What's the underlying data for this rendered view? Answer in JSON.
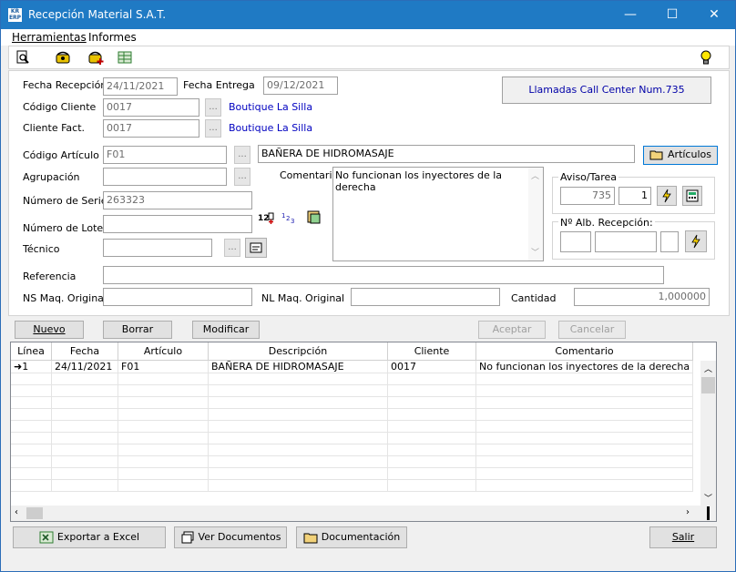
{
  "window": {
    "title": "Recepción Material S.A.T.",
    "app_icon_text": "KR ERP",
    "minimize": "—",
    "maximize": "☐",
    "close": "✕"
  },
  "menu": {
    "herramientas": "Herramientas",
    "informes": "Informes"
  },
  "form": {
    "fecha_recepcion_label": "Fecha Recepción",
    "fecha_recepcion_value": "24/11/2021",
    "fecha_entrega_label": "Fecha Entrega",
    "fecha_entrega_value": "09/12/2021",
    "codigo_cliente_label": "Código Cliente",
    "codigo_cliente_value": "0017",
    "codigo_cliente_name": "Boutique La Silla",
    "cliente_fact_label": "Cliente Fact.",
    "cliente_fact_value": "0017",
    "cliente_fact_name": "Boutique La Silla",
    "call_center": "Llamadas Call Center Num.735",
    "codigo_articulo_label": "Código Artículo",
    "codigo_articulo_value": "F01",
    "articulo_desc": "BAÑERA DE HIDROMASAJE",
    "articulos_button": "Artículos",
    "agrupacion_label": "Agrupación",
    "agrupacion_value": "",
    "comentario_label": "Comentario",
    "comentario_value": "No funcionan los inyectores de la derecha",
    "numero_serie_label": "Número de Serie",
    "numero_serie_value": "263323",
    "numero_lote_label": "Número de Lote",
    "numero_lote_value": "",
    "tecnico_label": "Técnico",
    "tecnico_value": "",
    "aviso_label": "Aviso/Tarea",
    "aviso_value": "735",
    "tarea_value": "1",
    "nalb_label": "Nº Alb. Recepción:",
    "referencia_label": "Referencia",
    "referencia_value": "",
    "ns_label": "NS Maq. Original",
    "ns_value": "",
    "nl_label": "NL Maq. Original",
    "nl_value": "",
    "cantidad_label": "Cantidad",
    "cantidad_value": "1,000000",
    "dots": "..."
  },
  "actions": {
    "nuevo": "Nuevo",
    "borrar": "Borrar",
    "modificar": "Modificar",
    "aceptar": "Aceptar",
    "cancelar": "Cancelar"
  },
  "grid": {
    "headers": [
      "Línea",
      "Fecha",
      "Artículo",
      "Descripción",
      "Cliente",
      "Comentario"
    ],
    "rows": [
      {
        "linea": "1",
        "fecha": "24/11/2021",
        "articulo": "F01",
        "descripcion": "BAÑERA DE HIDROMASAJE",
        "cliente": "0017",
        "comentario": "No funcionan los inyectores de la derecha"
      }
    ]
  },
  "footer": {
    "exportar": "Exportar a Excel",
    "ver_documentos": "Ver Documentos",
    "documentacion": "Documentación",
    "salir": "Salir"
  },
  "colors": {
    "titlebar": "#1f7ac4",
    "link": "#0000c0",
    "call_center_text": "#0000a8"
  },
  "icons": [
    "preview-icon",
    "phone-icon",
    "phone-add-icon",
    "excel-icon",
    "lightbulb-icon",
    "lightning-icon",
    "calculator-icon",
    "folder-icon",
    "documents-icon"
  ]
}
